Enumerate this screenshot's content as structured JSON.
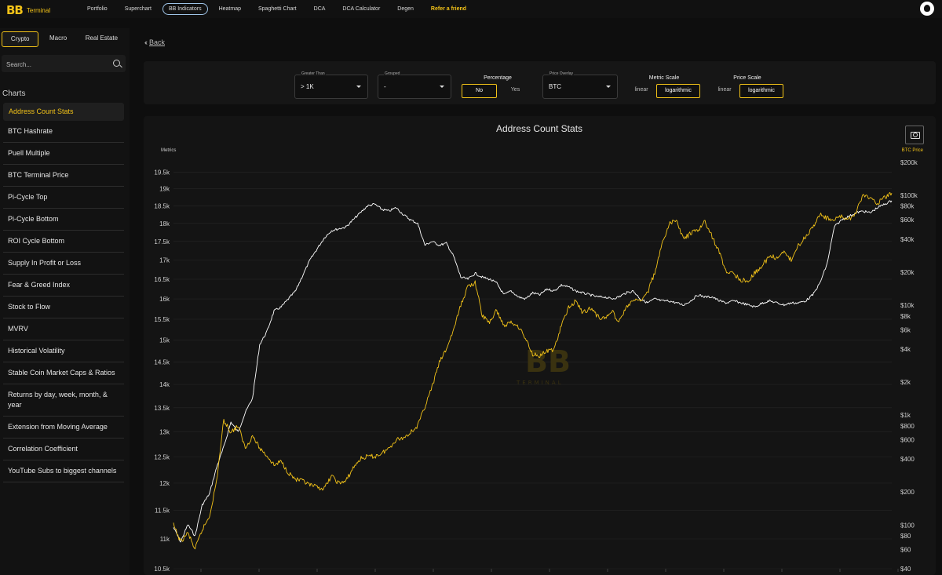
{
  "app": {
    "logo_mark": "BB",
    "logo_sub": "Terminal"
  },
  "nav": {
    "items": [
      {
        "label": "Portfolio"
      },
      {
        "label": "Superchart"
      },
      {
        "label": "BB Indicators",
        "active": true
      },
      {
        "label": "Heatmap"
      },
      {
        "label": "Spaghetti Chart"
      },
      {
        "label": "DCA"
      },
      {
        "label": "DCA Calculator"
      },
      {
        "label": "Degen"
      },
      {
        "label": "Refer a friend",
        "refer": true
      }
    ]
  },
  "sidebar": {
    "tabs": [
      {
        "label": "Crypto",
        "active": true
      },
      {
        "label": "Macro"
      },
      {
        "label": "Real Estate"
      }
    ],
    "search_placeholder": "Search...",
    "charts_label": "Charts",
    "items": [
      {
        "label": "Address Count Stats",
        "active": true
      },
      {
        "label": "BTC Hashrate"
      },
      {
        "label": "Puell Multiple"
      },
      {
        "label": "BTC Terminal Price"
      },
      {
        "label": "Pi-Cycle Top"
      },
      {
        "label": "Pi-Cycle Bottom"
      },
      {
        "label": "ROI Cycle Bottom"
      },
      {
        "label": "Supply In Profit or Loss"
      },
      {
        "label": "Fear & Greed Index"
      },
      {
        "label": "Stock to Flow"
      },
      {
        "label": "MVRV"
      },
      {
        "label": "Historical Volatility"
      },
      {
        "label": "Stable Coin Market Caps & Ratios"
      },
      {
        "label": "Returns by day, week, month, & year"
      },
      {
        "label": "Extension from Moving Average"
      },
      {
        "label": "Correlation Coefficient"
      },
      {
        "label": "YouTube Subs to biggest channels"
      }
    ]
  },
  "main": {
    "back_label": "Back",
    "filters": {
      "greater_than": {
        "label": "Greater Than",
        "value": "> 1K"
      },
      "grouped": {
        "label": "Grouped",
        "value": "-"
      },
      "percentage": {
        "title": "Percentage",
        "options": [
          "No",
          "Yes"
        ],
        "selected": "No"
      },
      "price_overlay": {
        "label": "Price Overlay",
        "value": "BTC"
      },
      "metric_scale": {
        "title": "Metric Scale",
        "options": [
          "linear",
          "logarithmic"
        ],
        "selected": "logarithmic"
      },
      "price_scale": {
        "title": "Price Scale",
        "options": [
          "linear",
          "logarithmic"
        ],
        "selected": "logarithmic"
      }
    }
  },
  "colors": {
    "accent": "#f2c218",
    "metric_line": "#ffffff",
    "price_line": "#f2c218",
    "background": "#0e0e0e",
    "panel": "#141414"
  },
  "chart_data": {
    "type": "line",
    "title": "Address Count Stats",
    "watermark": "BB",
    "watermark_sub": "TERMINAL",
    "y_left": {
      "label": "Metrics",
      "scale": "log",
      "range": [
        10500,
        19800
      ],
      "ticks": [
        10500,
        11000,
        11500,
        12000,
        12500,
        13000,
        13500,
        14000,
        14500,
        15000,
        15500,
        16000,
        16500,
        17000,
        17500,
        18000,
        18500,
        19000,
        19500
      ],
      "tick_labels": [
        "10.5k",
        "11k",
        "11.5k",
        "12k",
        "12.5k",
        "13k",
        "13.5k",
        "14k",
        "14.5k",
        "15k",
        "15.5k",
        "16k",
        "16.5k",
        "17k",
        "17.5k",
        "18k",
        "18.5k",
        "19k",
        "19.5k"
      ]
    },
    "y_right": {
      "label": "BTC Price",
      "scale": "log",
      "range": [
        40,
        200000
      ],
      "ticks": [
        40,
        60,
        80,
        100,
        200,
        400,
        600,
        800,
        1000,
        2000,
        4000,
        6000,
        8000,
        10000,
        20000,
        40000,
        60000,
        80000,
        100000,
        200000
      ],
      "tick_labels": [
        "$40",
        "$60",
        "$80",
        "$100",
        "$200",
        "$400",
        "$600",
        "$800",
        "$1k",
        "$2k",
        "$4k",
        "$6k",
        "$8k",
        "$10k",
        "$20k",
        "$40k",
        "$60k",
        "$80k",
        "$100k",
        "$200k"
      ]
    },
    "x_range": [
      0,
      100
    ],
    "series": [
      {
        "axis": "left",
        "color": "#ffffff",
        "points": [
          [
            0,
            11200
          ],
          [
            1,
            10950
          ],
          [
            2,
            11250
          ],
          [
            3,
            11050
          ],
          [
            4,
            11600
          ],
          [
            5,
            11800
          ],
          [
            6,
            12300
          ],
          [
            7,
            12700
          ],
          [
            8,
            13200
          ],
          [
            9,
            13000
          ],
          [
            10,
            13400
          ],
          [
            11,
            13700
          ],
          [
            12,
            14900
          ],
          [
            13,
            15200
          ],
          [
            14,
            15700
          ],
          [
            15,
            15800
          ],
          [
            16,
            16000
          ],
          [
            17,
            16200
          ],
          [
            18,
            16600
          ],
          [
            19,
            17000
          ],
          [
            20,
            17300
          ],
          [
            21,
            17600
          ],
          [
            22,
            17800
          ],
          [
            23,
            17850
          ],
          [
            24,
            17900
          ],
          [
            25,
            18100
          ],
          [
            26,
            18300
          ],
          [
            27,
            18500
          ],
          [
            28,
            18550
          ],
          [
            29,
            18400
          ],
          [
            30,
            18350
          ],
          [
            31,
            18450
          ],
          [
            32,
            18250
          ],
          [
            33,
            18100
          ],
          [
            34,
            18000
          ],
          [
            35,
            17400
          ],
          [
            36,
            17500
          ],
          [
            37,
            17400
          ],
          [
            38,
            17450
          ],
          [
            39,
            17100
          ],
          [
            40,
            16550
          ],
          [
            41,
            16500
          ],
          [
            42,
            16650
          ],
          [
            43,
            16550
          ],
          [
            44,
            16500
          ],
          [
            45,
            16400
          ],
          [
            46,
            16100
          ],
          [
            47,
            16200
          ],
          [
            48,
            16050
          ],
          [
            49,
            16000
          ],
          [
            50,
            16150
          ],
          [
            51,
            16100
          ],
          [
            52,
            16250
          ],
          [
            53,
            16200
          ],
          [
            54,
            16350
          ],
          [
            55,
            16300
          ],
          [
            56,
            16200
          ],
          [
            57,
            16150
          ],
          [
            58,
            16100
          ],
          [
            59,
            16050
          ],
          [
            60,
            16050
          ],
          [
            61,
            16000
          ],
          [
            62,
            16050
          ],
          [
            63,
            16150
          ],
          [
            64,
            16200
          ],
          [
            65,
            16000
          ],
          [
            66,
            15900
          ],
          [
            67,
            16000
          ],
          [
            68,
            15950
          ],
          [
            69,
            15950
          ],
          [
            70,
            15900
          ],
          [
            71,
            15850
          ],
          [
            72,
            15950
          ],
          [
            73,
            16100
          ],
          [
            74,
            16050
          ],
          [
            75,
            16050
          ],
          [
            76,
            15950
          ],
          [
            77,
            15900
          ],
          [
            78,
            15950
          ],
          [
            79,
            15900
          ],
          [
            80,
            15850
          ],
          [
            81,
            15800
          ],
          [
            82,
            15900
          ],
          [
            83,
            15950
          ],
          [
            84,
            15900
          ],
          [
            85,
            15850
          ],
          [
            86,
            15900
          ],
          [
            87,
            15900
          ],
          [
            88,
            15950
          ],
          [
            89,
            16100
          ],
          [
            90,
            16400
          ],
          [
            91,
            16900
          ],
          [
            92,
            17900
          ],
          [
            93,
            18100
          ],
          [
            94,
            18200
          ],
          [
            95,
            18300
          ],
          [
            96,
            18350
          ],
          [
            97,
            18300
          ],
          [
            98,
            18450
          ],
          [
            99,
            18550
          ],
          [
            100,
            18650
          ]
        ]
      },
      {
        "axis": "right",
        "color": "#f2c218",
        "points": [
          [
            0,
            100
          ],
          [
            1,
            70
          ],
          [
            2,
            85
          ],
          [
            3,
            60
          ],
          [
            4,
            90
          ],
          [
            5,
            120
          ],
          [
            6,
            250
          ],
          [
            7,
            900
          ],
          [
            8,
            700
          ],
          [
            9,
            800
          ],
          [
            10,
            500
          ],
          [
            11,
            650
          ],
          [
            12,
            500
          ],
          [
            13,
            430
          ],
          [
            14,
            350
          ],
          [
            15,
            380
          ],
          [
            16,
            300
          ],
          [
            17,
            260
          ],
          [
            18,
            250
          ],
          [
            19,
            230
          ],
          [
            20,
            220
          ],
          [
            21,
            215
          ],
          [
            22,
            280
          ],
          [
            23,
            240
          ],
          [
            24,
            250
          ],
          [
            25,
            330
          ],
          [
            26,
            400
          ],
          [
            27,
            420
          ],
          [
            28,
            420
          ],
          [
            29,
            450
          ],
          [
            30,
            500
          ],
          [
            31,
            600
          ],
          [
            32,
            620
          ],
          [
            33,
            700
          ],
          [
            34,
            800
          ],
          [
            35,
            1200
          ],
          [
            36,
            1800
          ],
          [
            37,
            3000
          ],
          [
            38,
            4000
          ],
          [
            39,
            6000
          ],
          [
            40,
            10000
          ],
          [
            41,
            15000
          ],
          [
            42,
            16000
          ],
          [
            43,
            8000
          ],
          [
            44,
            7000
          ],
          [
            45,
            9000
          ],
          [
            46,
            6500
          ],
          [
            47,
            7000
          ],
          [
            48,
            6500
          ],
          [
            49,
            5000
          ],
          [
            50,
            3600
          ],
          [
            51,
            3500
          ],
          [
            52,
            3800
          ],
          [
            53,
            4000
          ],
          [
            54,
            6500
          ],
          [
            55,
            9500
          ],
          [
            56,
            11000
          ],
          [
            57,
            8500
          ],
          [
            58,
            9500
          ],
          [
            59,
            8000
          ],
          [
            60,
            7500
          ],
          [
            61,
            9000
          ],
          [
            62,
            7000
          ],
          [
            63,
            9500
          ],
          [
            64,
            11000
          ],
          [
            65,
            11000
          ],
          [
            66,
            13000
          ],
          [
            67,
            20000
          ],
          [
            68,
            35000
          ],
          [
            69,
            55000
          ],
          [
            70,
            60000
          ],
          [
            71,
            40000
          ],
          [
            72,
            45000
          ],
          [
            73,
            48000
          ],
          [
            74,
            58000
          ],
          [
            75,
            42000
          ],
          [
            76,
            30000
          ],
          [
            77,
            20000
          ],
          [
            78,
            19500
          ],
          [
            79,
            17000
          ],
          [
            80,
            16500
          ],
          [
            81,
            20000
          ],
          [
            82,
            23000
          ],
          [
            83,
            28000
          ],
          [
            84,
            27000
          ],
          [
            85,
            30000
          ],
          [
            86,
            26000
          ],
          [
            87,
            35000
          ],
          [
            88,
            42000
          ],
          [
            89,
            52000
          ],
          [
            90,
            67000
          ],
          [
            91,
            62000
          ],
          [
            92,
            60000
          ],
          [
            93,
            65000
          ],
          [
            94,
            60000
          ],
          [
            95,
            70000
          ],
          [
            96,
            100000
          ],
          [
            97,
            95000
          ],
          [
            98,
            85000
          ],
          [
            99,
            95000
          ],
          [
            100,
            105000
          ]
        ]
      }
    ]
  }
}
